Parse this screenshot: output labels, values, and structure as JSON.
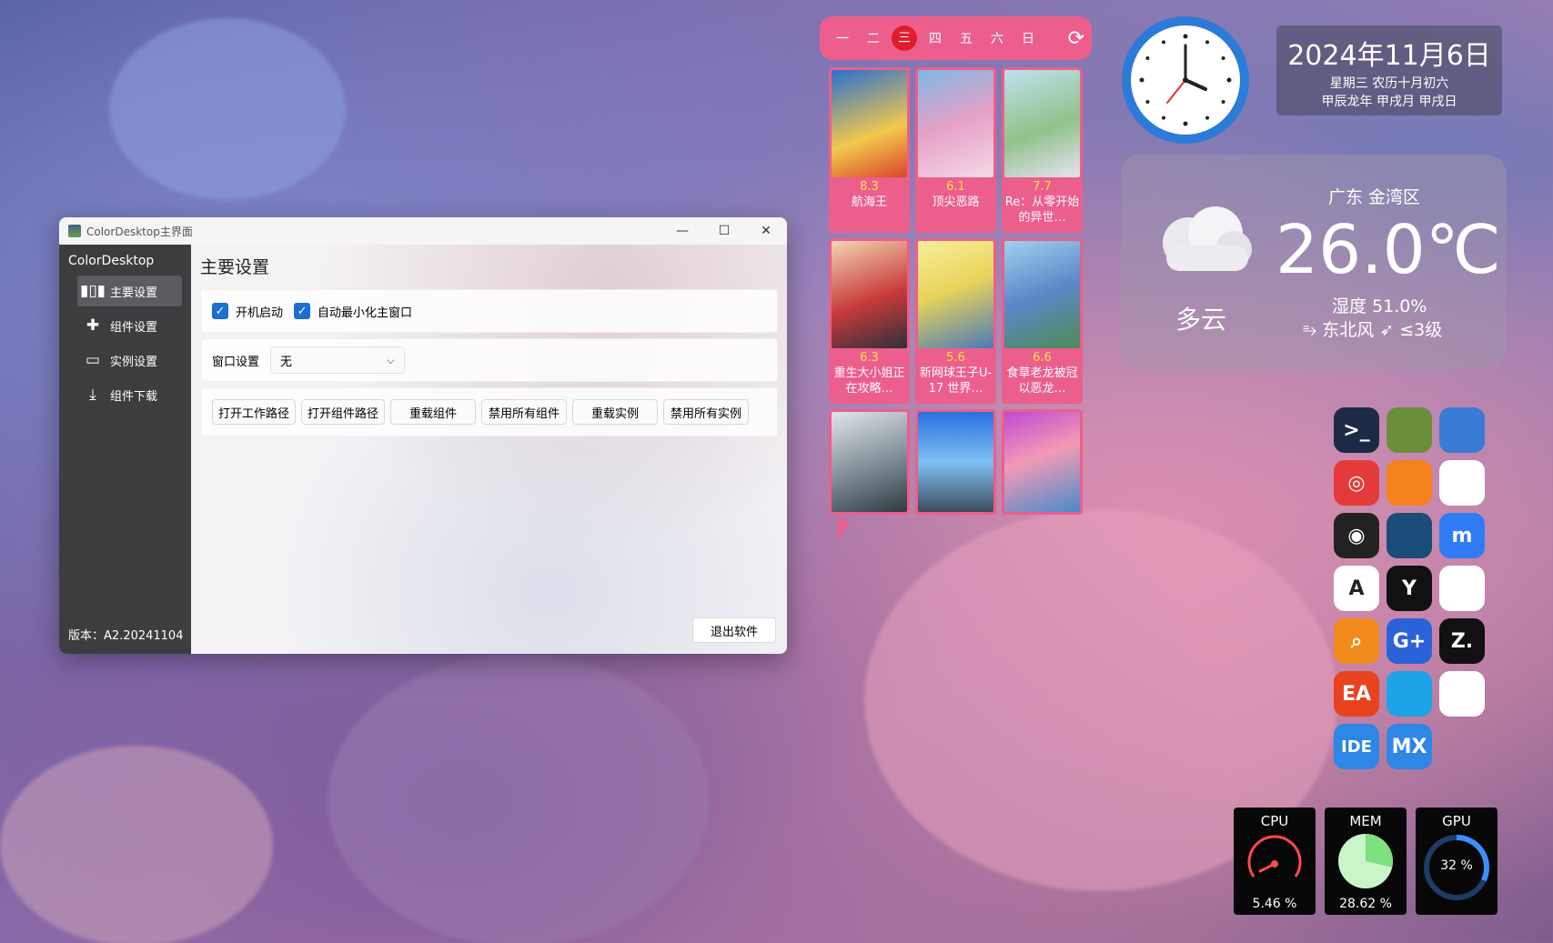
{
  "window": {
    "title": "ColorDesktop主界面",
    "brand": "ColorDesktop",
    "nav": [
      {
        "label": "主要设置",
        "icon": "settings-panel-icon"
      },
      {
        "label": "组件设置",
        "icon": "puzzle-icon"
      },
      {
        "label": "实例设置",
        "icon": "window-icon"
      },
      {
        "label": "组件下载",
        "icon": "download-icon"
      }
    ],
    "version": "版本：A2.20241104",
    "page_title": "主要设置",
    "checkboxes": [
      {
        "label": "开机启动",
        "checked": true
      },
      {
        "label": "自动最小化主窗口",
        "checked": true
      }
    ],
    "window_setting_label": "窗口设置",
    "window_setting_value": "无",
    "buttons": [
      "打开工作路径",
      "打开组件路径",
      "重载组件",
      "禁用所有组件",
      "重载实例",
      "禁用所有实例"
    ],
    "exit_label": "退出软件"
  },
  "schedule": {
    "days": [
      "一",
      "二",
      "三",
      "四",
      "五",
      "六",
      "日"
    ],
    "active_day": "三",
    "anime": [
      {
        "score": "8.3",
        "title": "航海王"
      },
      {
        "score": "6.1",
        "title": "顶尖恶路"
      },
      {
        "score": "7.7",
        "title": "Re：从零开始的异世…"
      },
      {
        "score": "6.3",
        "title": "重生大小姐正在攻略…"
      },
      {
        "score": "5.6",
        "title": "新网球王子U-17 世界…"
      },
      {
        "score": "6.6",
        "title": "食草老龙被冠以恶龙…"
      },
      {
        "score": "",
        "title": ""
      },
      {
        "score": "",
        "title": ""
      },
      {
        "score": "",
        "title": ""
      }
    ]
  },
  "date": {
    "main": "2024年11月6日",
    "line1": "星期三  农历十月初六",
    "line2": "甲辰龙年 甲戌月 甲戌日"
  },
  "weather": {
    "region": "广东  金湾区",
    "temp": "26.0℃",
    "condition": "多云",
    "humidity": "湿度 51.0%",
    "wind": "⥱ 东北风  ➶ ≤3级"
  },
  "apps": [
    {
      "name": "terminal-app-icon",
      "text": ">_",
      "color": "#1d2a45"
    },
    {
      "name": "minecraft-app-icon",
      "text": "",
      "color": "#6b8e3d"
    },
    {
      "name": "remote-desktop-app-icon",
      "text": "",
      "color": "#3a7bd5"
    },
    {
      "name": "netease-music-app-icon",
      "text": "◎",
      "color": "#e43a3a"
    },
    {
      "name": "orange-app-icon",
      "text": "",
      "color": "#f5821f"
    },
    {
      "name": "qq-app-icon",
      "text": "",
      "color": "#ffffff"
    },
    {
      "name": "obs-app-icon",
      "text": "◉",
      "color": "#222222"
    },
    {
      "name": "steam-app-icon",
      "text": "",
      "color": "#1b4d7a"
    },
    {
      "name": "m-app-icon",
      "text": "m",
      "color": "#2f7cf6"
    },
    {
      "name": "appstore-app-icon",
      "text": "A",
      "color": "#ffffff"
    },
    {
      "name": "y-app-icon",
      "text": "Y",
      "color": "#111111"
    },
    {
      "name": "animal-app-icon",
      "text": "",
      "color": "#ffffff"
    },
    {
      "name": "everything-app-icon",
      "text": "⌕",
      "color": "#f08a1c"
    },
    {
      "name": "gplus-app-icon",
      "text": "G+",
      "color": "#2a63d9"
    },
    {
      "name": "z-app-icon",
      "text": "Z.",
      "color": "#111111"
    },
    {
      "name": "ea-app-icon",
      "text": "EA",
      "color": "#e8431f"
    },
    {
      "name": "blue-app-icon",
      "text": "",
      "color": "#1ca3e8"
    },
    {
      "name": "cat-app-icon",
      "text": "",
      "color": "#ffffff"
    },
    {
      "name": "ide-app-icon",
      "text": "IDE",
      "color": "#2e86e6"
    },
    {
      "name": "mx-app-icon",
      "text": "MX",
      "color": "#2e86e6"
    }
  ],
  "monitors": [
    {
      "label": "CPU",
      "value": "5.46 %",
      "fraction": 0.0546,
      "color": "#ff4a4a"
    },
    {
      "label": "MEM",
      "value": "28.62 %",
      "fraction": 0.2862,
      "color": "#7fe07f"
    },
    {
      "label": "GPU",
      "value": "32 %",
      "fraction": 0.32,
      "color": "#3a8fff"
    }
  ]
}
